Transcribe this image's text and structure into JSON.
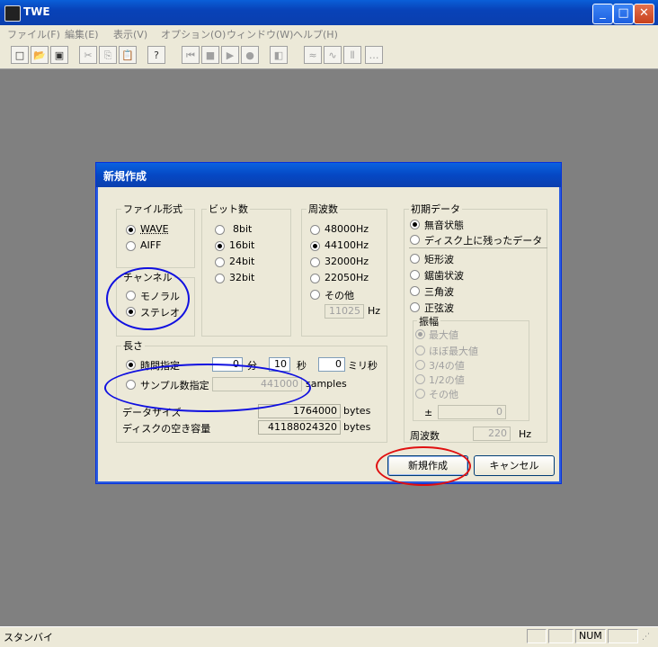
{
  "window": {
    "title": "TWE"
  },
  "menu": [
    "ファイル(F)",
    "編集(E)",
    "表示(V)",
    "オプション(O)",
    "ウィンドウ(W)",
    "ヘルプ(H)"
  ],
  "toolbar": {
    "icons": [
      "new-icon",
      "open-icon",
      "save-icon",
      "cut-icon",
      "copy-icon",
      "paste-icon",
      "help-icon",
      "rewind-icon",
      "stop-icon",
      "play-icon",
      "record-icon",
      "mute-icon",
      "wave-icon",
      "wave2-icon",
      "marker-icon",
      "scroll-icon"
    ],
    "glyphs": [
      "□",
      "📂",
      "▣",
      "✂",
      "⎘",
      "📋",
      "?",
      "⏮",
      "■",
      "▶",
      "●",
      "◧",
      "≈",
      "∿",
      "⫴",
      "…"
    ]
  },
  "dialog": {
    "title": "新規作成",
    "file_format": {
      "label": "ファイル形式",
      "options": [
        "WAVE",
        "AIFF"
      ],
      "selected": "WAVE"
    },
    "bits": {
      "label": "ビット数",
      "options": [
        "8bit",
        "16bit",
        "24bit",
        "32bit"
      ],
      "selected": "16bit"
    },
    "frequency": {
      "label": "周波数",
      "options": [
        "48000Hz",
        "44100Hz",
        "32000Hz",
        "22050Hz",
        "その他"
      ],
      "selected": "44100Hz",
      "other_value": "11025",
      "unit": "Hz"
    },
    "channel": {
      "label": "チャンネル",
      "options": [
        "モノラル",
        "ステレオ"
      ],
      "selected": "ステレオ"
    },
    "length": {
      "label": "長さ",
      "time_label": "時間指定",
      "minutes": "0",
      "minutes_unit": "分",
      "seconds": "10",
      "seconds_unit": "秒",
      "ms": "0",
      "ms_unit": "ミリ秒",
      "sample_label": "サンプル数指定",
      "samples": "441000",
      "samples_unit": "samples",
      "selected": "time",
      "data_size_label": "データサイズ",
      "data_size": "1764000",
      "data_size_unit": "bytes",
      "disk_free_label": "ディスクの空き容量",
      "disk_free": "41188024320",
      "disk_free_unit": "bytes"
    },
    "initial": {
      "label": "初期データ",
      "options": [
        "無音状態",
        "ディスク上に残ったデータ",
        "矩形波",
        "鋸歯状波",
        "三角波",
        "正弦波"
      ],
      "selected": "無音状態",
      "amplitude": {
        "label": "振幅",
        "options": [
          "最大値",
          "ほぼ最大値",
          "3/4の値",
          "1/2の値",
          "その他"
        ],
        "selected": "最大値",
        "pm": "±",
        "value": "0"
      },
      "freq_label": "周波数",
      "freq_value": "220",
      "freq_unit": "Hz"
    },
    "ok_button": "新規作成",
    "cancel_button": "キャンセル"
  },
  "annotations": {
    "colors": [
      "#1010e0",
      "#e01010"
    ]
  },
  "status": {
    "text": "スタンバイ",
    "num": "NUM"
  }
}
